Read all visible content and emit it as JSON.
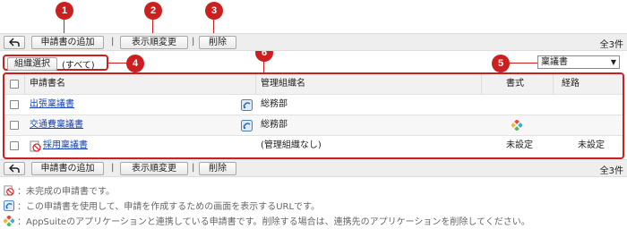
{
  "callouts": [
    "1",
    "2",
    "3",
    "4",
    "5",
    "6"
  ],
  "toolbar": {
    "add_label": "申請書の追加",
    "order_label": "表示順変更",
    "delete_label": "削除",
    "separator": "|",
    "count": "全3件"
  },
  "filter": {
    "org_select_label": "組織選択",
    "org_scope": "(すべて)",
    "type_selected": "稟議書"
  },
  "table": {
    "headers": [
      "申請書名",
      "管理組織名",
      "書式",
      "経路"
    ],
    "rows": [
      {
        "name": "出張稟議書",
        "org": "総務部",
        "format": "",
        "route": ""
      },
      {
        "name": "交通費稟議書",
        "org": "総務部",
        "format": "",
        "route": ""
      },
      {
        "name": "採用稟議書",
        "org": "(管理組織なし)",
        "format": "未設定",
        "route": "未設定"
      }
    ]
  },
  "legend": {
    "incomplete": "：未完成の申請書です。",
    "url": "：この申請書を使用して、申請を作成するための画面を表示するURLです。",
    "appsuite": "：AppSuiteのアプリケーションと連携している申請書です。削除する場合は、連携先のアプリケーションを削除してください。"
  },
  "colors": {
    "callout": "#cc1f1f",
    "link": "#1a45b8",
    "toolbar_bg": "#eeeeee"
  }
}
